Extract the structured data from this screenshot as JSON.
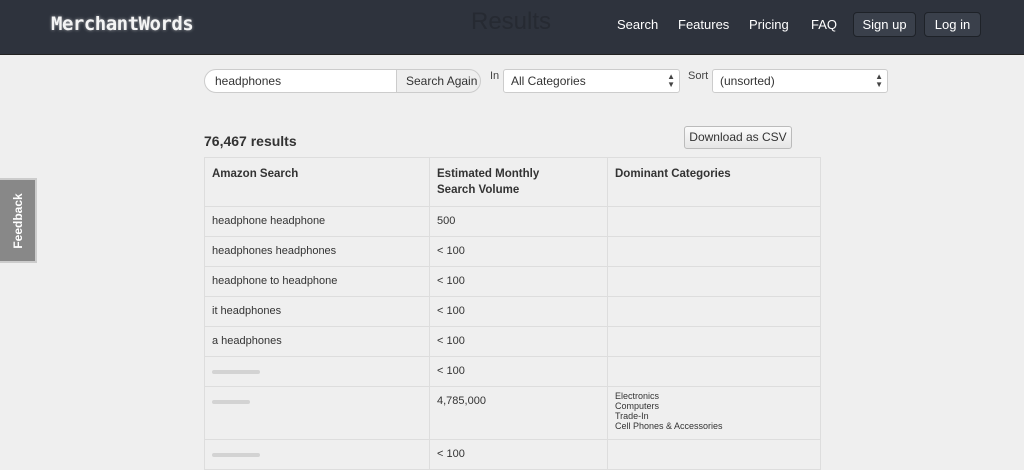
{
  "header": {
    "logo": "MerchantWords",
    "page_title": "Results",
    "nav": [
      "Search",
      "Features",
      "Pricing",
      "FAQ"
    ],
    "signup": "Sign up",
    "login": "Log in"
  },
  "search": {
    "query": "headphones",
    "button": "Search Again",
    "in_label": "In",
    "category": "All Categories",
    "sort_label": "Sort",
    "sort": "(unsorted)"
  },
  "results": {
    "count": "76,467 results",
    "download": "Download as CSV"
  },
  "table": {
    "headers": [
      "Amazon Search",
      "Estimated Monthly Search Volume",
      "Dominant Categories"
    ],
    "rows": [
      {
        "search": "headphone headphone",
        "volume": "500"
      },
      {
        "search": "headphones headphones",
        "volume": "< 100"
      },
      {
        "search": "headphone to headphone",
        "volume": "< 100"
      },
      {
        "search": "it headphones",
        "volume": "< 100"
      },
      {
        "search": "a headphones",
        "volume": "< 100"
      },
      {
        "volume": "< 100"
      },
      {
        "volume": "4,785,000",
        "categories": [
          "Electronics",
          "Computers",
          "Trade-In",
          "Cell Phones & Accessories"
        ]
      },
      {
        "volume": "< 100"
      }
    ]
  },
  "feedback": "Feedback"
}
